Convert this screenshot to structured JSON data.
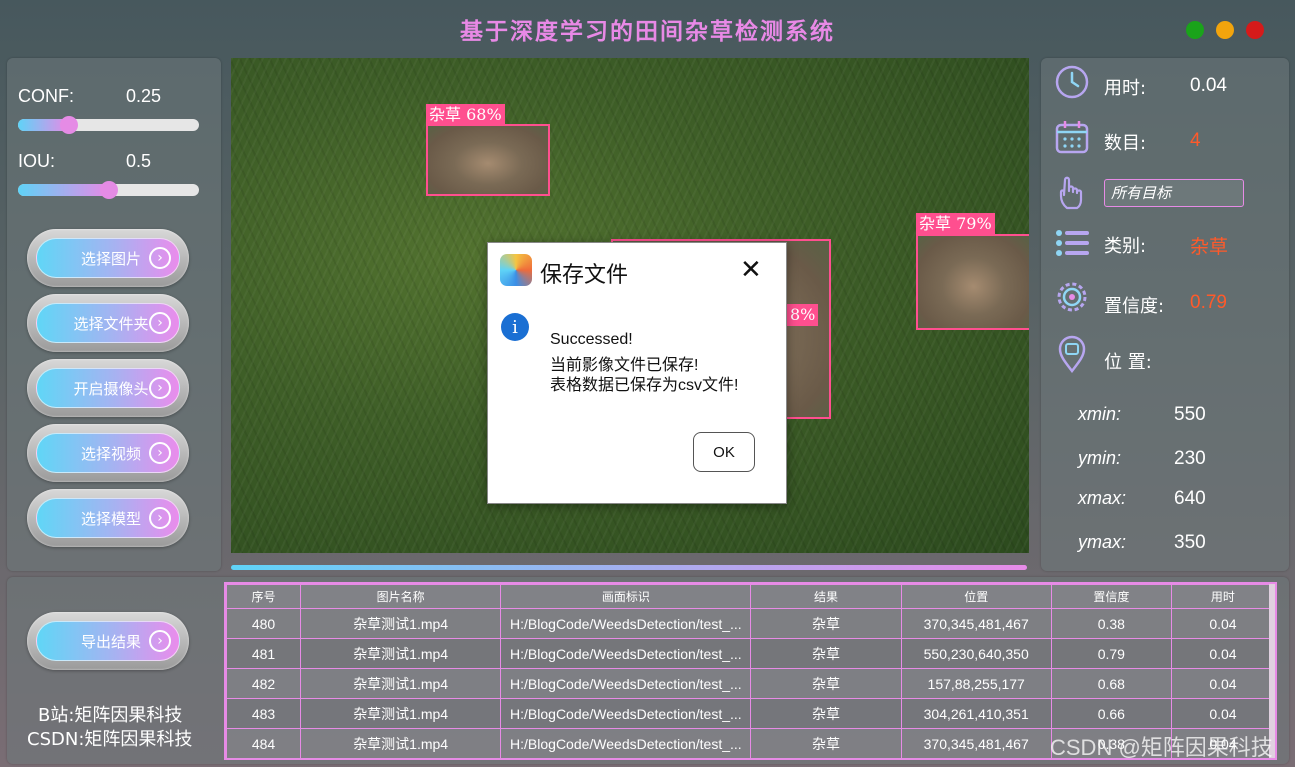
{
  "app": {
    "title": "基于深度学习的田间杂草检测系统"
  },
  "controls": {
    "conf": {
      "label": "CONF:",
      "value": "0.25",
      "level": 0.28
    },
    "iou": {
      "label": "IOU:",
      "value": "0.5",
      "level": 0.5
    },
    "buttons": [
      {
        "label": "选择图片"
      },
      {
        "label": "选择文件夹"
      },
      {
        "label": "开启摄像头"
      },
      {
        "label": "选择视频"
      },
      {
        "label": "选择模型"
      }
    ]
  },
  "viewer": {
    "detections": [
      {
        "tag": "杂草 68%"
      },
      {
        "tag": "杂草 79%"
      },
      {
        "tag": "8%"
      }
    ]
  },
  "info": {
    "time_label": "用时:",
    "time_value": "0.04",
    "count_label": "数目:",
    "count_value": "4",
    "target_select": "所有目标",
    "class_label": "类别:",
    "class_value": "杂草",
    "conf_label": "置信度:",
    "conf_value": "0.79",
    "position_label": "位 置:",
    "coords": [
      {
        "label": "xmin:",
        "value": "550"
      },
      {
        "label": "ymin:",
        "value": "230"
      },
      {
        "label": "xmax:",
        "value": "640"
      },
      {
        "label": "ymax:",
        "value": "350"
      }
    ],
    "accent_color": "#ff5a2a"
  },
  "bottom": {
    "export_label": "导出结果",
    "credit_bilibili": "B站:矩阵因果科技",
    "credit_csdn": "CSDN:矩阵因果科技"
  },
  "table": {
    "headers": [
      "序号",
      "图片名称",
      "画面标识",
      "结果",
      "位置",
      "置信度",
      "用时"
    ],
    "rows": [
      [
        "480",
        "杂草测试1.mp4",
        "H:/BlogCode/WeedsDetection/test_...",
        "杂草",
        "370,345,481,467",
        "0.38",
        "0.04"
      ],
      [
        "481",
        "杂草测试1.mp4",
        "H:/BlogCode/WeedsDetection/test_...",
        "杂草",
        "550,230,640,350",
        "0.79",
        "0.04"
      ],
      [
        "482",
        "杂草测试1.mp4",
        "H:/BlogCode/WeedsDetection/test_...",
        "杂草",
        "157,88,255,177",
        "0.68",
        "0.04"
      ],
      [
        "483",
        "杂草测试1.mp4",
        "H:/BlogCode/WeedsDetection/test_...",
        "杂草",
        "304,261,410,351",
        "0.66",
        "0.04"
      ],
      [
        "484",
        "杂草测试1.mp4",
        "H:/BlogCode/WeedsDetection/test_...",
        "杂草",
        "370,345,481,467",
        "0.38",
        "0.04"
      ]
    ]
  },
  "dialog": {
    "title": "保存文件",
    "line1": "Successed!",
    "line2": "当前影像文件已保存!",
    "line3": "表格数据已保存为csv文件!",
    "ok_label": "OK"
  },
  "watermark": "CSDN @矩阵因果科技"
}
